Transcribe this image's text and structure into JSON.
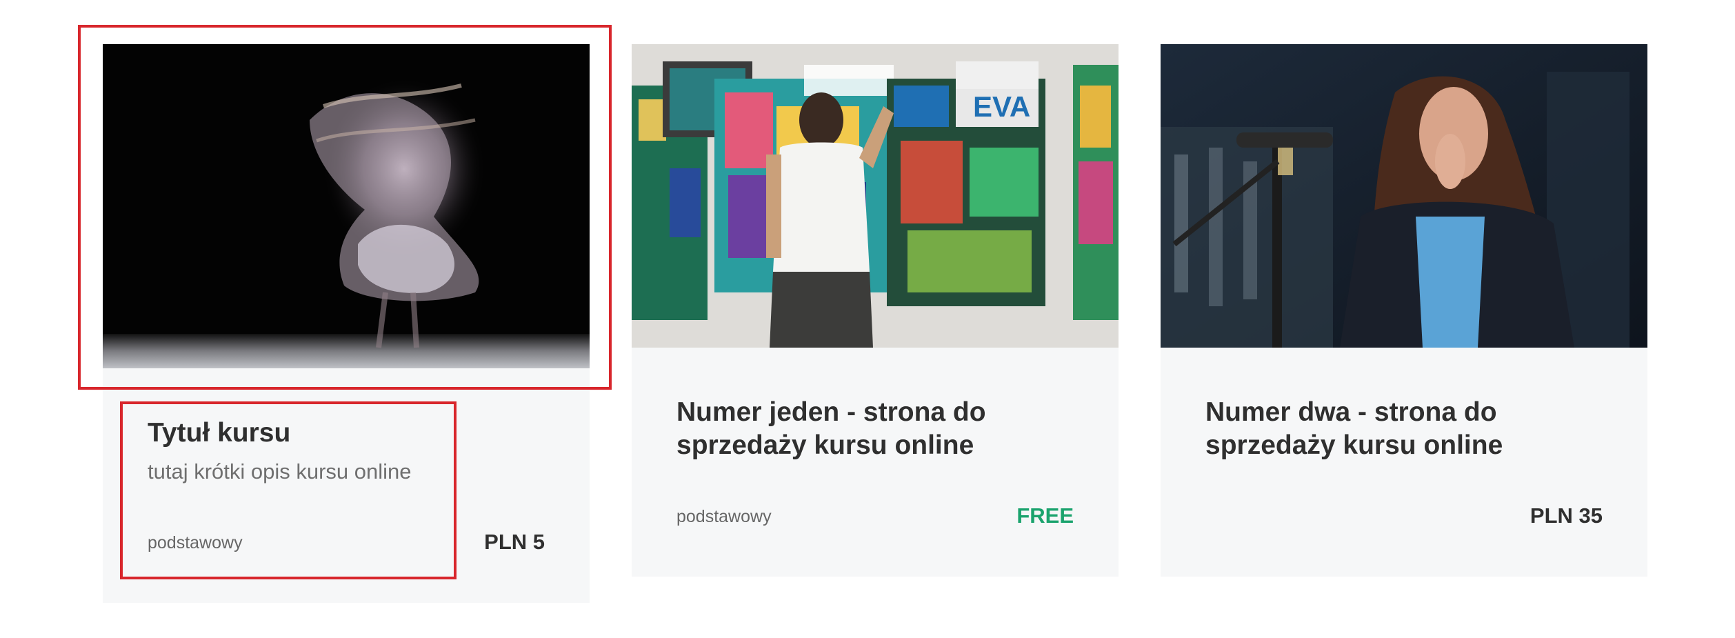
{
  "courses": [
    {
      "title": "Tytuł kursu",
      "description": "tutaj krótki opis kursu online",
      "level": "podstawowy",
      "price": "PLN 5",
      "image": "dancer-motion-blur-photo"
    },
    {
      "title": "Numer jeden - strona do sprzedaży kursu online",
      "description": "",
      "level": "podstawowy",
      "price": "FREE",
      "image": "street-artist-painting-wall-photo"
    },
    {
      "title": "Numer dwa - strona do sprzedaży kursu online",
      "description": "",
      "level": "",
      "price": "PLN 35",
      "image": "singer-microphone-photo"
    }
  ],
  "colors": {
    "card_background": "#f6f7f8",
    "free_price": "#1aa36d",
    "highlight_border": "#d8262c"
  }
}
